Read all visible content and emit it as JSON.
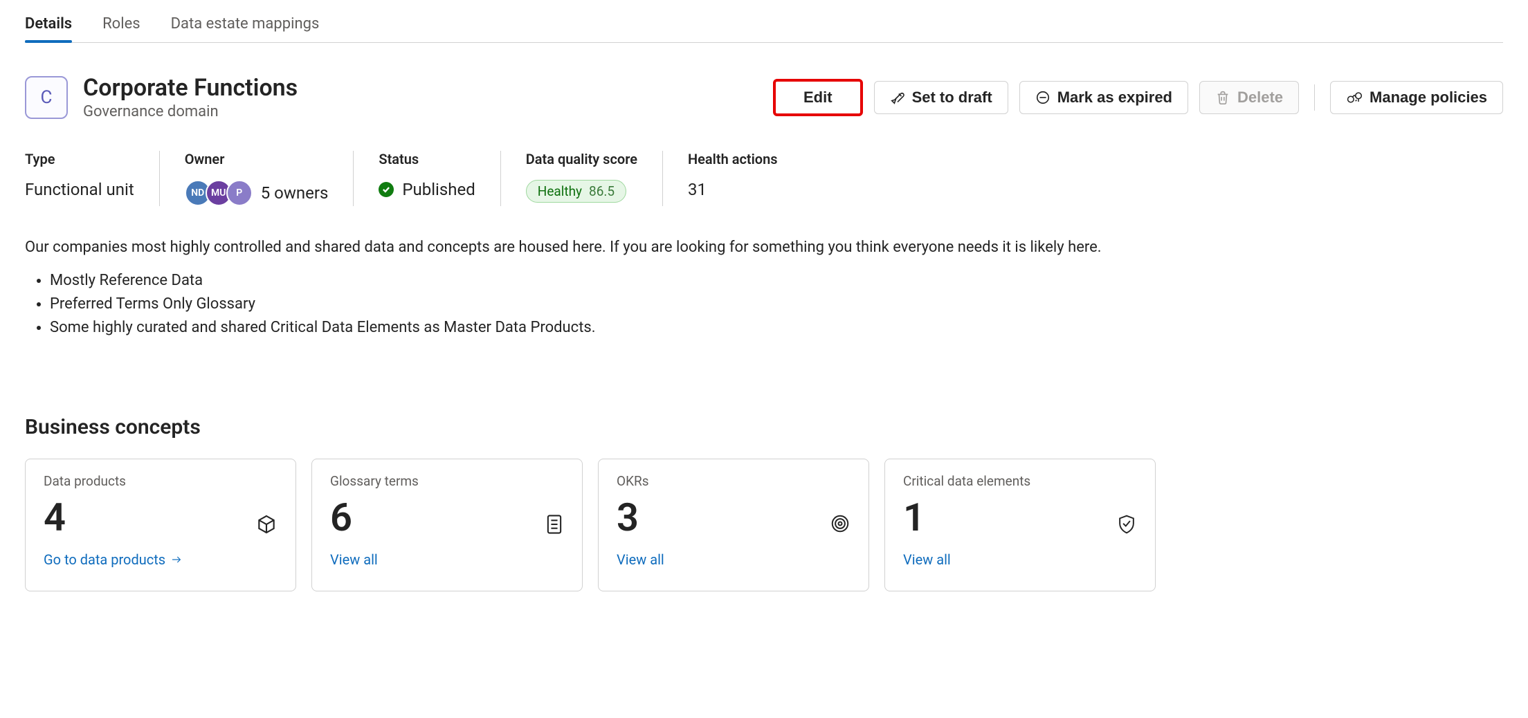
{
  "tabs": [
    {
      "label": "Details",
      "active": true
    },
    {
      "label": "Roles",
      "active": false
    },
    {
      "label": "Data estate mappings",
      "active": false
    }
  ],
  "domain": {
    "initial": "C",
    "title": "Corporate Functions",
    "subtitle": "Governance domain"
  },
  "actions": {
    "edit": "Edit",
    "set_to_draft": "Set to draft",
    "mark_expired": "Mark as expired",
    "delete": "Delete",
    "manage_policies": "Manage policies"
  },
  "meta": {
    "type": {
      "label": "Type",
      "value": "Functional unit"
    },
    "owner": {
      "label": "Owner",
      "avatars": [
        "ND",
        "MU",
        "P"
      ],
      "count_text": "5 owners"
    },
    "status": {
      "label": "Status",
      "value": "Published"
    },
    "dq": {
      "label": "Data quality score",
      "status": "Healthy",
      "score": "86.5"
    },
    "health": {
      "label": "Health actions",
      "value": "31"
    }
  },
  "description": {
    "text": "Our companies most highly controlled and shared data and concepts are housed here. If you are looking for something you think everyone needs it is likely here.",
    "bullets": [
      "Mostly Reference Data",
      "Preferred Terms Only Glossary",
      "Some highly curated and shared Critical Data Elements as Master Data Products."
    ]
  },
  "concepts": {
    "title": "Business concepts",
    "cards": [
      {
        "label": "Data products",
        "count": "4",
        "link": "Go to data products"
      },
      {
        "label": "Glossary terms",
        "count": "6",
        "link": "View all"
      },
      {
        "label": "OKRs",
        "count": "3",
        "link": "View all"
      },
      {
        "label": "Critical data elements",
        "count": "1",
        "link": "View all"
      }
    ]
  }
}
